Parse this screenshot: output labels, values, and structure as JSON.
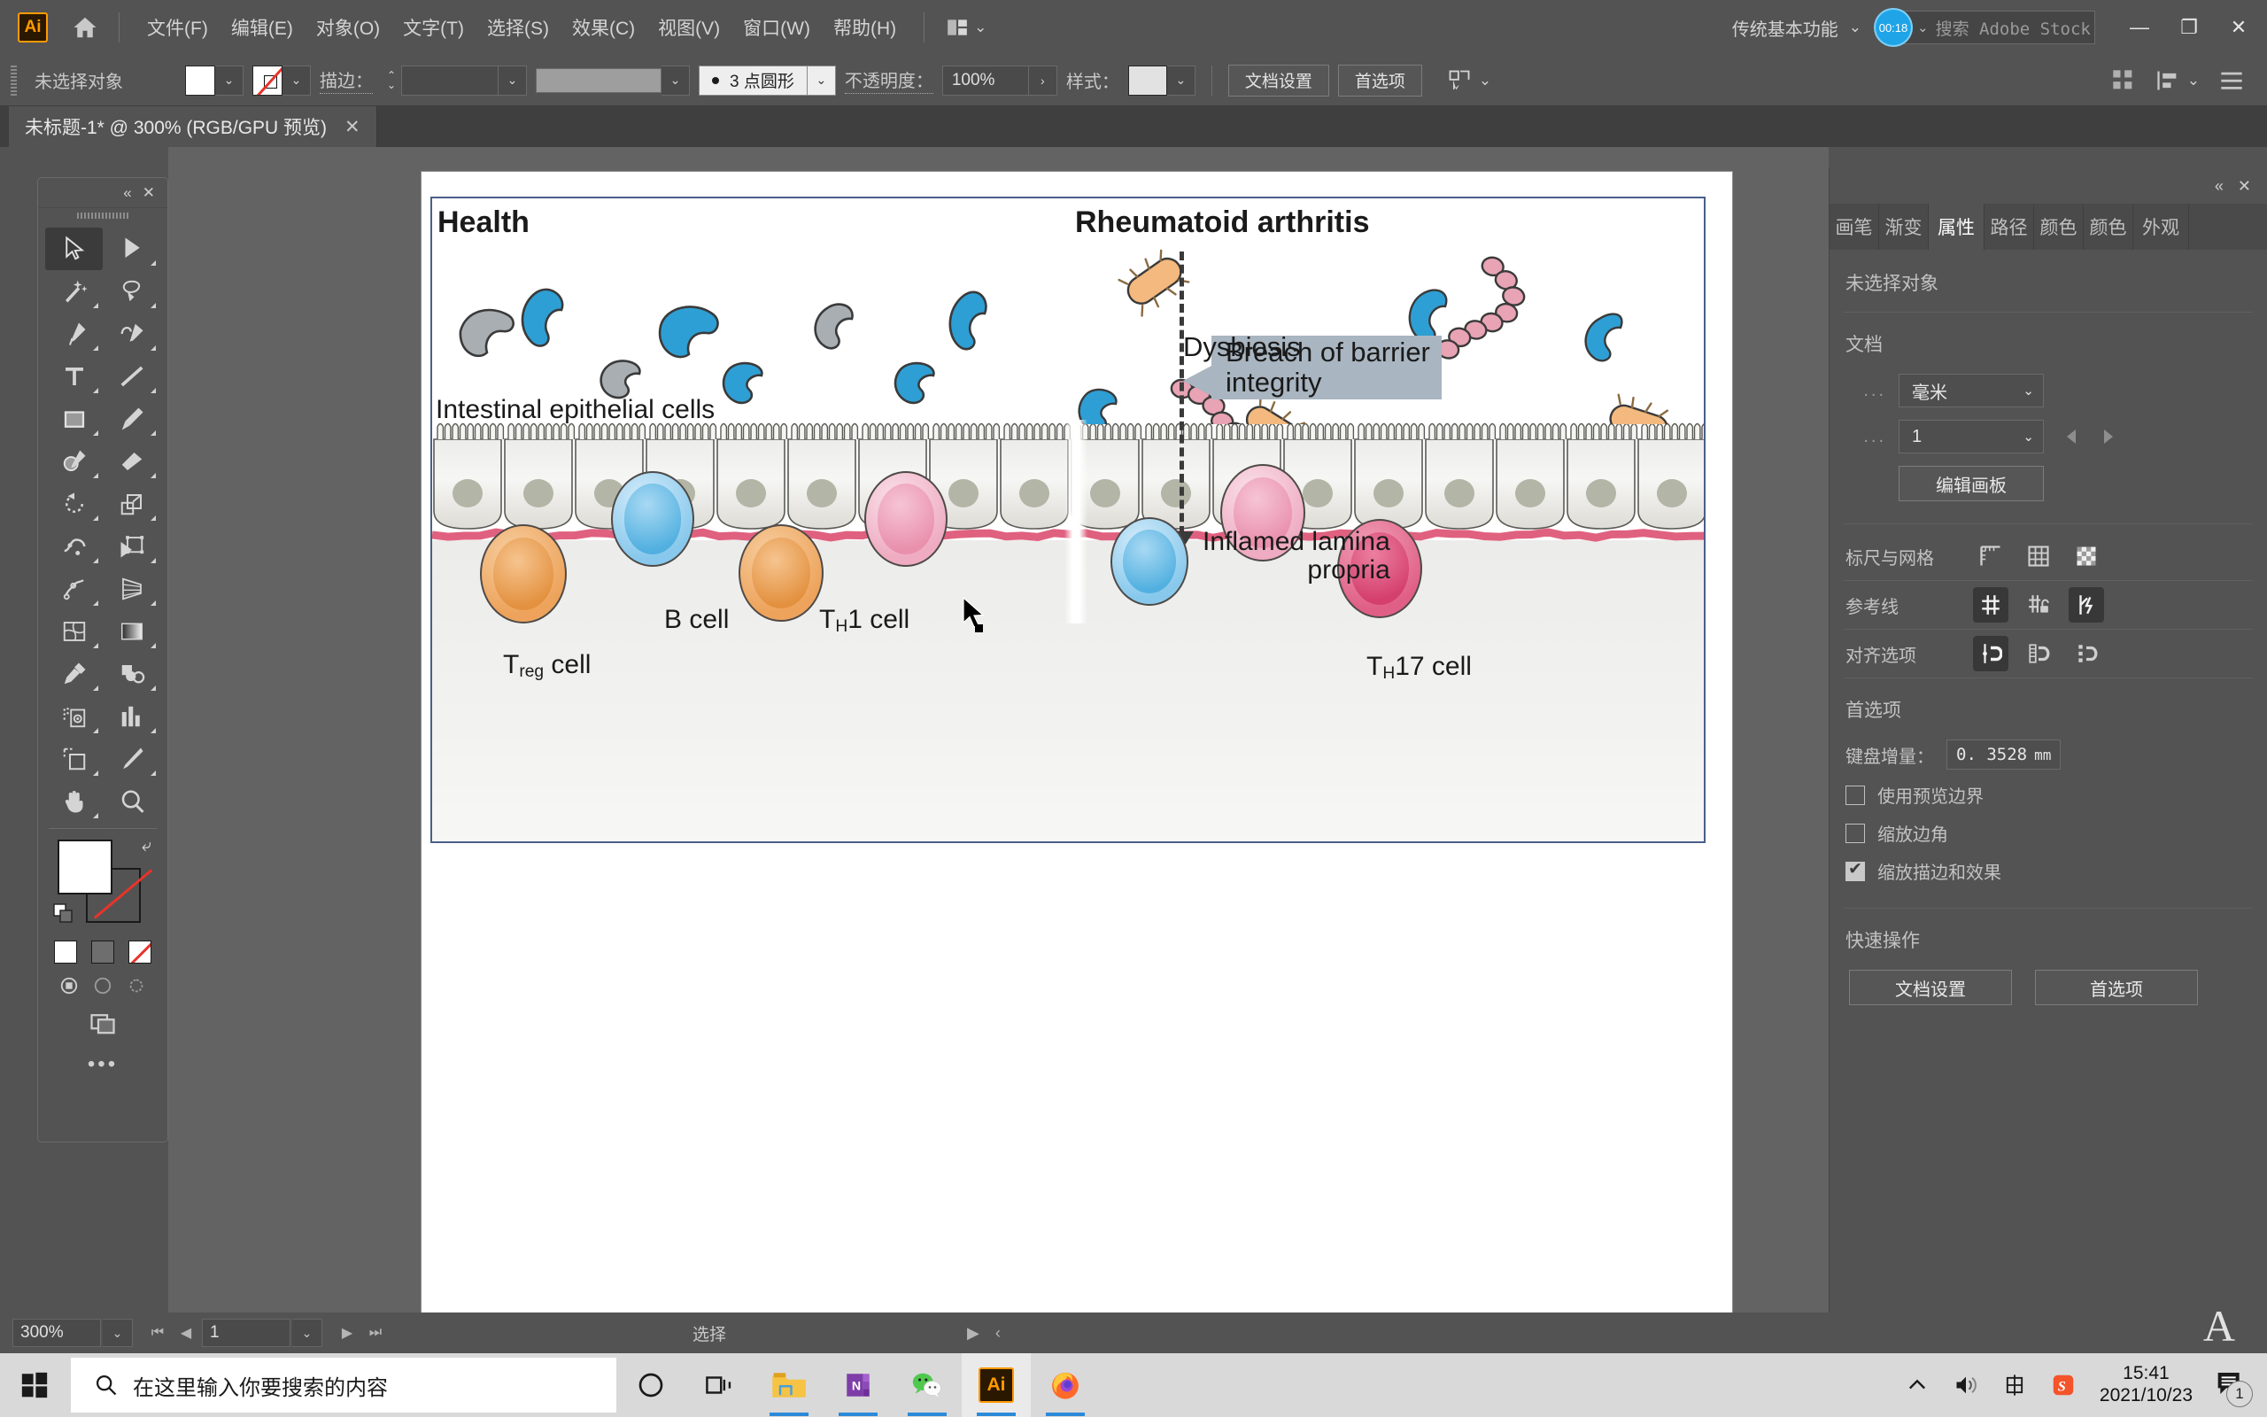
{
  "app": {
    "logo": "Ai",
    "menus": [
      "文件(F)",
      "编辑(E)",
      "对象(O)",
      "文字(T)",
      "选择(S)",
      "效果(C)",
      "视图(V)",
      "窗口(W)",
      "帮助(H)"
    ],
    "arrange_icon": "arrange-documents-icon",
    "workspace": "传统基本功能",
    "timer": "00:18",
    "stock_search_placeholder": "搜索 Adobe Stock",
    "window_minimize": "—",
    "window_maximize": "❐",
    "window_close": "✕"
  },
  "controlbar": {
    "selection_status": "未选择对象",
    "fill_label": "fill-swatch",
    "stroke_label": "stroke-swatch",
    "stroke_text": "描边：",
    "stroke_weight": "",
    "profile": "3 点圆形",
    "opacity_label": "不透明度：",
    "opacity_value": "100%",
    "style_label": "样式：",
    "document_setup": "文档设置",
    "preferences": "首选项",
    "select_similar_icon": "select-similar-objects-icon"
  },
  "document_tab": {
    "title": "未标题-1* @ 300% (RGB/GPU 预览)",
    "close": "✕"
  },
  "toolbar": {
    "collapse": "«",
    "close": "✕",
    "tools": [
      "selection-tool",
      "direct-selection-tool",
      "magic-wand-tool",
      "lasso-tool",
      "pen-tool",
      "curvature-tool",
      "type-tool",
      "line-segment-tool",
      "rectangle-tool",
      "paintbrush-tool",
      "shaper-tool",
      "eraser-tool",
      "rotate-tool",
      "scale-tool",
      "width-tool",
      "free-transform-tool",
      "shape-builder-tool",
      "perspective-grid-tool",
      "mesh-tool",
      "gradient-tool",
      "eyedropper-tool",
      "blend-tool",
      "symbol-sprayer-tool",
      "column-graph-tool",
      "artboard-tool",
      "slice-tool",
      "hand-tool",
      "zoom-tool"
    ],
    "fill_color": "#ffffff",
    "stroke_color": "none",
    "more": "•••"
  },
  "properties_panel": {
    "collapse": "«",
    "close": "✕",
    "tabs": [
      "画笔",
      "渐变",
      "属性",
      "路径",
      "颜色",
      "颜色",
      "外观"
    ],
    "active_tab": "属性",
    "no_selection": "未选择对象",
    "document_section": "文档",
    "unit_dots": "...",
    "unit_value": "毫米",
    "artboard_dots": "...",
    "artboard_value": "1",
    "edit_artboards": "编辑画板",
    "rulers_grid_label": "标尺与网格",
    "rulers_grid_icons": [
      "ruler-icon",
      "grid-icon",
      "transparency-grid-icon"
    ],
    "guides_label": "参考线",
    "guides_icons": [
      "show-guides-icon",
      "lock-guides-icon",
      "smart-guides-icon"
    ],
    "snap_label": "对齐选项",
    "snap_icons": [
      "snap-to-point-icon",
      "snap-to-grid-icon",
      "snap-to-pixel-icon"
    ],
    "preferences_section": "首选项",
    "keyboard_increment_label": "键盘增量：",
    "keyboard_increment_value": "0. 3528",
    "keyboard_increment_unit": "mm",
    "checkboxes": [
      {
        "label": "使用预览边界",
        "checked": false
      },
      {
        "label": "缩放边角",
        "checked": false
      },
      {
        "label": "缩放描边和效果",
        "checked": true
      }
    ],
    "quick_actions_section": "快速操作",
    "quick_actions": [
      "文档设置",
      "首选项"
    ]
  },
  "statusbar": {
    "zoom": "300%",
    "page": "1",
    "status_text": "选择",
    "first_icon": "first-artboard-icon",
    "prev_icon": "previous-artboard-icon",
    "next_icon": "next-artboard-icon",
    "last_icon": "last-artboard-icon"
  },
  "taskbar": {
    "start_icon": "windows-start-icon",
    "search_placeholder": "在这里输入你要搜索的内容",
    "cortana_icon": "cortana-circle-icon",
    "taskview_icon": "task-view-icon",
    "apps": [
      "file-explorer-icon",
      "onenote-icon",
      "wechat-icon",
      "illustrator-icon",
      "firefox-icon"
    ],
    "tray": [
      "show-hidden-icons-chevron",
      "volume-icon",
      "ime-chinese-icon",
      "sogou-input-icon"
    ],
    "time": "15:41",
    "date": "2021/10/23",
    "notification_count": "1"
  },
  "artwork": {
    "title_health": "Health",
    "title_ra": "Rheumatoid arthritis",
    "label_dysbiosis": "Dysbiosis",
    "label_epithelial": "Intestinal epithelial cells",
    "callout_line1": "Breach of barrier",
    "callout_line2": "integrity",
    "label_inflamed_1": "Inflamed lamina",
    "label_inflamed_2": "propria",
    "label_bcell": "B cell",
    "label_th1_pre": "T",
    "label_th1_sub": "H",
    "label_th1_post": "1 cell",
    "label_treg_pre": "T",
    "label_treg_sub": "reg",
    "label_treg_post": " cell",
    "label_th17_pre": "T",
    "label_th17_sub": "H",
    "label_th17_post": "17 cell",
    "colors": {
      "blue_bacteria": "#2e9fd4",
      "gray_bacteria": "#a8aeb2",
      "orange_bacteria": "#f3b97e",
      "pink_chain": "#e8a3b4",
      "callout_bg": "#a9b5c0",
      "basement_membrane": "#e0617f",
      "bcell": "#7ec6ee",
      "treg": "#f0a863",
      "th1": "#efa8bc",
      "th17": "#e3traditional"
    }
  }
}
